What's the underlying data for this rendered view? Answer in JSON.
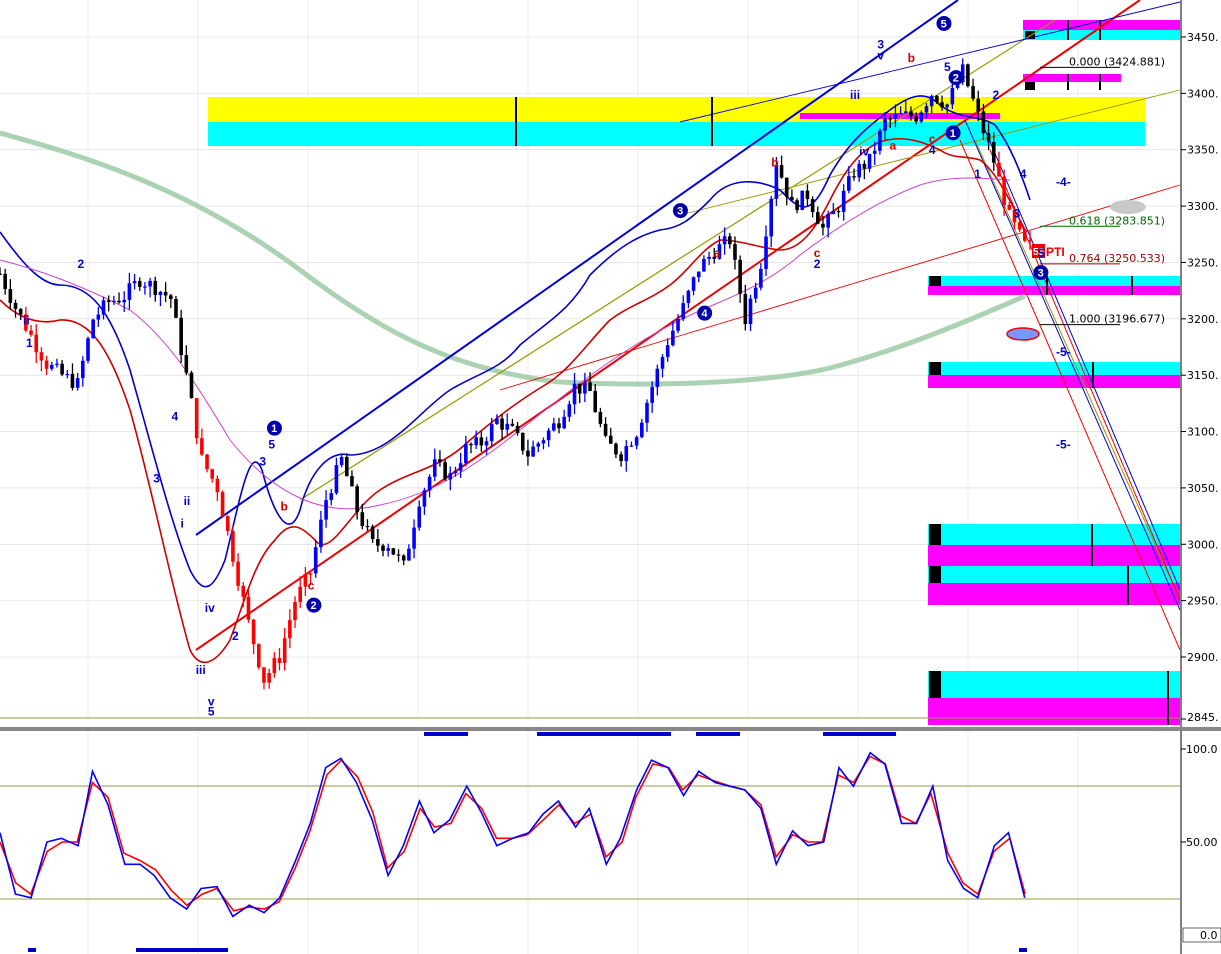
{
  "colors": {
    "up_bar": "#0000ff",
    "down_bar": "#000000",
    "red_bar": "#ff0000",
    "env_upper": "#0000cc",
    "env_lower": "#cc0000",
    "ma_mid": "#cc44cc",
    "ma_long": "#a8d0b0",
    "channel_blue": "#0000dd",
    "channel_red": "#ee0000",
    "olive": "#999900",
    "zone_yellow": "#ffff00",
    "zone_cyan": "#00ffff",
    "zone_magenta": "#ff00ff",
    "stoch_k": "#0000ff",
    "stoch_d": "#ff0000",
    "stoch_level": "#999944",
    "grid": "#d9d9d9",
    "fib_black": "#000000",
    "fib_green": "#006600",
    "fib_red": "#990000"
  },
  "chart_data": [
    {
      "type": "candlestick",
      "yaxis_ticks": [
        "3450.",
        "3400.",
        "3350.",
        "3300.",
        "3250.",
        "3200.",
        "3150.",
        "3100.",
        "3050.",
        "3000.",
        "2950.",
        "2900.",
        "2845."
      ],
      "ylim": [
        2845,
        3470
      ],
      "n_bars": 200,
      "x": [
        0,
        3,
        6,
        9,
        12,
        15,
        18,
        21,
        24,
        27,
        30,
        33,
        36,
        39,
        42,
        45,
        48,
        51,
        54,
        57,
        60,
        63,
        66,
        69,
        72,
        75,
        78,
        81,
        84,
        87,
        90,
        93,
        96,
        99,
        102,
        105,
        108,
        111,
        114,
        117,
        120,
        123,
        126,
        129,
        132,
        135,
        138,
        141,
        144,
        147,
        150,
        153,
        156,
        159,
        162,
        165,
        168,
        171,
        174,
        177,
        180,
        183,
        186,
        189,
        192,
        195,
        198
      ],
      "close": [
        3240,
        3210,
        3185,
        3160,
        3150,
        3142,
        3200,
        3215,
        3220,
        3235,
        3228,
        3218,
        3150,
        3075,
        3050,
        2990,
        2930,
        2880,
        2900,
        2950,
        2975,
        3040,
        3075,
        3030,
        3000,
        3000,
        2980,
        3040,
        3070,
        3060,
        3085,
        3090,
        3110,
        3100,
        3080,
        3095,
        3110,
        3140,
        3135,
        3090,
        3080,
        3100,
        3140,
        3180,
        3210,
        3245,
        3260,
        3270,
        3200,
        3250,
        3340,
        3300,
        3310,
        3280,
        3300,
        3330,
        3340,
        3375,
        3380,
        3380,
        3400,
        3390,
        3420,
        3380,
        3340,
        3290,
        3265
      ],
      "fib_levels": [
        {
          "label": "0.000 (3424.881)",
          "value": 3424.881,
          "color": "#000000"
        },
        {
          "label": "0.618 (3283.851)",
          "value": 3283.851,
          "color": "#006600"
        },
        {
          "label": "0.764 (3250.533)",
          "value": 3250.533,
          "color": "#990000"
        },
        {
          "label": "1.000 (3196.677)",
          "value": 3196.677,
          "color": "#000000"
        }
      ],
      "tag": "PTI",
      "tag_value": "55",
      "zones": [
        {
          "y_top": 3400,
          "y_mid": 3375,
          "y_bot": 3353,
          "kind": "yellow-cyan"
        },
        {
          "y_top": 3462,
          "y_mid": 3450,
          "y_bot": 3440,
          "kind": "magenta-cyan"
        },
        {
          "y_top": 3417,
          "y_mid": 3410,
          "y_bot": 3403,
          "kind": "magenta"
        },
        {
          "y_top": 3238,
          "y_mid": 3230,
          "y_bot": 3221,
          "kind": "cyan-magenta"
        },
        {
          "y_top": 3162,
          "y_mid": 3150,
          "y_bot": 3138,
          "kind": "cyan-magenta"
        },
        {
          "y_top": 3017,
          "y_mid": 2997,
          "y_bot": 2978,
          "kind": "cyan-magenta"
        },
        {
          "y_top": 2978,
          "y_mid": 2963,
          "y_bot": 2947,
          "kind": "cyan-magenta"
        },
        {
          "y_top": 2883,
          "y_mid": 2862,
          "y_bot": 2840,
          "kind": "cyan-magenta"
        }
      ],
      "wave_labels": [
        {
          "text": "1",
          "x": 2,
          "y": 3175,
          "color": "#0000cc"
        },
        {
          "text": "ii",
          "x": 1,
          "y": 3195,
          "color": "#0000cc"
        },
        {
          "text": "2",
          "x": 19,
          "y": 3245,
          "color": "#0000cc"
        },
        {
          "text": "3",
          "x": 44,
          "y": 3055,
          "color": "#0000cc"
        },
        {
          "text": "4",
          "x": 50,
          "y": 3110,
          "color": "#0000cc"
        },
        {
          "text": "ii",
          "x": 54,
          "y": 3035,
          "color": "#0000cc"
        },
        {
          "text": "i",
          "x": 53,
          "y": 3015,
          "color": "#0000cc"
        },
        {
          "text": "iv",
          "x": 61,
          "y": 2940,
          "color": "#0000cc"
        },
        {
          "text": "iii",
          "x": 58,
          "y": 2885,
          "color": "#0000cc"
        },
        {
          "text": "v",
          "x": 62,
          "y": 2857,
          "color": "#0000cc"
        },
        {
          "text": "5",
          "x": 62,
          "y": 2848,
          "color": "#0000cc"
        },
        {
          "text": "2",
          "x": 70,
          "y": 2915,
          "color": "#0000cc"
        },
        {
          "text": "3",
          "x": 79,
          "y": 3070,
          "color": "#0000cc"
        },
        {
          "text": "5",
          "x": 82,
          "y": 3085,
          "color": "#0000cc"
        },
        {
          "text": "b",
          "x": 86,
          "y": 3030,
          "color": "#cc0000"
        },
        {
          "text": "c",
          "x": 95,
          "y": 2960,
          "color": "#cc0000"
        },
        {
          "text": "a",
          "x": 229,
          "y": 3255,
          "color": "#cc0000"
        },
        {
          "text": "b",
          "x": 248,
          "y": 3335,
          "color": "#cc0000"
        },
        {
          "text": "c",
          "x": 262,
          "y": 3255,
          "color": "#cc0000"
        },
        {
          "text": "2",
          "x": 262,
          "y": 3245,
          "color": "#0000cc"
        },
        {
          "text": "iii",
          "x": 274,
          "y": 3395,
          "color": "#0000cc"
        },
        {
          "text": "iv",
          "x": 277,
          "y": 3345,
          "color": "#0000cc"
        },
        {
          "text": "3",
          "x": 283,
          "y": 3440,
          "color": "#0000cc"
        },
        {
          "text": "v",
          "x": 283,
          "y": 3430,
          "color": "#0000cc"
        },
        {
          "text": "a",
          "x": 287,
          "y": 3350,
          "color": "#cc0000"
        },
        {
          "text": "b",
          "x": 293,
          "y": 3428,
          "color": "#cc0000"
        },
        {
          "text": "c",
          "x": 300,
          "y": 3356,
          "color": "#cc0000"
        },
        {
          "text": "4",
          "x": 300,
          "y": 3346,
          "color": "#0000cc"
        },
        {
          "text": "5",
          "x": 305,
          "y": 3420,
          "color": "#0000cc"
        },
        {
          "text": "1",
          "x": 315,
          "y": 3325,
          "color": "#0000cc"
        },
        {
          "text": "2",
          "x": 321,
          "y": 3395,
          "color": "#0000cc"
        },
        {
          "text": "3",
          "x": 328,
          "y": 3290,
          "color": "#0000cc"
        },
        {
          "text": "4",
          "x": 330,
          "y": 3325,
          "color": "#0000cc"
        },
        {
          "text": "5",
          "x": 336,
          "y": 3255,
          "color": "#0000cc"
        },
        {
          "text": "-4-",
          "x": 342,
          "y": 3318,
          "color": "#0000cc"
        },
        {
          "text": "-5-",
          "x": 342,
          "y": 3167,
          "color": "#0000cc"
        },
        {
          "text": "-5-",
          "x": 342,
          "y": 3085,
          "color": "#0000cc"
        }
      ],
      "circled_labels": [
        {
          "text": "1",
          "x": 84,
          "y": 3103
        },
        {
          "text": "2",
          "x": 97,
          "y": 2946
        },
        {
          "text": "3",
          "x": 218,
          "y": 3296
        },
        {
          "text": "4",
          "x": 226,
          "y": 3205
        },
        {
          "text": "5",
          "x": 305,
          "y": 3462
        },
        {
          "text": "2",
          "x": 309,
          "y": 3414
        },
        {
          "text": "1",
          "x": 308,
          "y": 3365
        },
        {
          "text": "3",
          "x": 337,
          "y": 3241
        }
      ]
    },
    {
      "type": "line",
      "yaxis_ticks": [
        "100.0",
        "50.00",
        "0.0"
      ],
      "ylim": [
        0,
        100
      ],
      "series": [
        {
          "key": "k",
          "x": [
            0,
            3,
            6,
            9,
            12,
            15,
            18,
            21,
            24,
            27,
            30,
            33,
            36,
            39,
            42,
            45,
            48,
            51,
            54,
            57,
            60,
            63,
            66,
            69,
            72,
            75,
            78,
            81,
            84,
            87,
            90,
            93,
            96,
            99,
            102,
            105,
            108,
            111,
            114,
            117,
            120,
            123,
            126,
            129,
            132,
            135,
            138,
            141,
            144,
            147,
            150,
            153,
            156,
            159,
            162,
            165,
            168,
            171,
            174,
            177,
            180,
            183,
            186,
            189,
            192,
            195,
            198
          ],
          "values": [
            55,
            22,
            20,
            50,
            52,
            48,
            88,
            70,
            38,
            38,
            32,
            20,
            14,
            25,
            26,
            10,
            16,
            12,
            20,
            40,
            60,
            90,
            95,
            82,
            62,
            32,
            48,
            72,
            55,
            62,
            80,
            66,
            48,
            52,
            55,
            65,
            72,
            58,
            68,
            38,
            52,
            78,
            94,
            90,
            75,
            88,
            82,
            80,
            78,
            68,
            38,
            56,
            48,
            50,
            90,
            80,
            98,
            92,
            60,
            60,
            80,
            40,
            25,
            20,
            48,
            55,
            20
          ]
        },
        {
          "key": "d",
          "x": [
            0,
            3,
            6,
            9,
            12,
            15,
            18,
            21,
            24,
            27,
            30,
            33,
            36,
            39,
            42,
            45,
            48,
            51,
            54,
            57,
            60,
            63,
            66,
            69,
            72,
            75,
            78,
            81,
            84,
            87,
            90,
            93,
            96,
            99,
            102,
            105,
            108,
            111,
            114,
            117,
            120,
            123,
            126,
            129,
            132,
            135,
            138,
            141,
            144,
            147,
            150,
            153,
            156,
            159,
            162,
            165,
            168,
            171,
            174,
            177,
            180,
            183,
            186,
            189,
            192,
            195,
            198
          ],
          "values": [
            50,
            28,
            22,
            45,
            50,
            50,
            82,
            74,
            44,
            40,
            35,
            24,
            16,
            22,
            25,
            13,
            15,
            14,
            18,
            36,
            56,
            86,
            94,
            85,
            66,
            36,
            45,
            68,
            58,
            60,
            76,
            68,
            52,
            52,
            54,
            62,
            70,
            60,
            65,
            42,
            50,
            74,
            92,
            90,
            78,
            86,
            83,
            80,
            78,
            70,
            42,
            54,
            50,
            50,
            86,
            82,
            96,
            92,
            64,
            60,
            76,
            44,
            28,
            22,
            45,
            52,
            22
          ]
        }
      ]
    }
  ]
}
